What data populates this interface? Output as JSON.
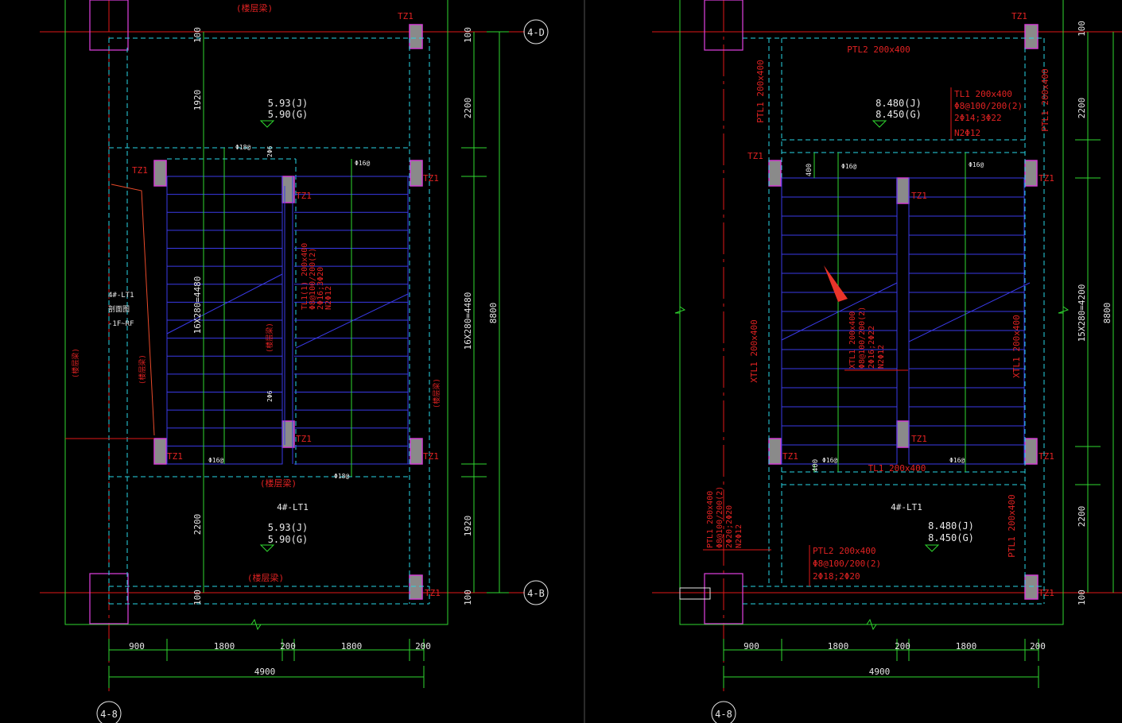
{
  "colors": {
    "background": "#000000",
    "dimension": "#2fd82f",
    "axis": "#e01818",
    "beam_dashed": "#29d6e6",
    "stair": "#3a3ae8",
    "wall": "#d23cd2",
    "column_fill": "#8a8a8a",
    "text": "#e8e8e8",
    "annotation": "#e02222"
  },
  "axes": {
    "top": "4-D",
    "bottom": "4-B",
    "left": "4-8"
  },
  "dims": {
    "bottom_row": [
      "900",
      "1800",
      "200",
      "1800",
      "200"
    ],
    "total": "4900",
    "d100": "100",
    "d1920": "1920",
    "d2200": "2200",
    "height": "8800"
  },
  "left": {
    "flight": "16X280=4480",
    "side_flight": "16X280=4480",
    "top_label": "(楼层梁)",
    "top_elev": [
      "5.93(J)",
      "5.90(G)"
    ],
    "bottom_elev": [
      "5.93(J)",
      "5.90(G)"
    ],
    "stair_name": "4#-LT1",
    "side_note": [
      "4#-LT1",
      "剖面图",
      "-1F~RF"
    ],
    "beam_label": [
      "TL1(1) 200x400",
      "Φ8@100/200(2)",
      "2Φ16;3Φ20",
      "N2Φ12"
    ],
    "rebar_top": "Φ18@",
    "rebar_top2": "Φ16@",
    "rebar_bottom": "Φ16@",
    "rebar_bottom2": "Φ18@",
    "mid_label": "2Φ6",
    "vertical_label": "(楼层梁)",
    "tz": "TZ1"
  },
  "right": {
    "flight": "15X280=4200",
    "ptl2_top": "PTL2 200x400",
    "ptl1_left": "PTL1 200x400",
    "ptl1_right": "PTL1 200x400",
    "top_elev": [
      "8.480(J)",
      "8.450(G)"
    ],
    "bottom_elev": [
      "8.480(J)",
      "8.450(G)"
    ],
    "tl1_top": [
      "TL1 200x400",
      "Φ8@100/200(2)",
      "2Φ14;3Φ22",
      "N2Φ12"
    ],
    "tl1_bottom": "TL1 200x400",
    "xtl1_left": "XTL1 200x400",
    "xtl1_right": "XTL1 200x400",
    "xtl1_mid": [
      "XTL1 200x400",
      "Φ8@100/200(2)",
      "2Φ16;2Φ22",
      "N2Φ12"
    ],
    "ptl1_bl": [
      "PTL1 200x400",
      "Φ8@100/200(2)",
      "2Φ20;2Φ20",
      "N2Φ12"
    ],
    "ptl2_bottom": [
      "PTL2 200x400",
      "Φ8@100/200(2)",
      "2Φ18;2Φ20"
    ],
    "stair_name": "4#-LT1",
    "dim400": "400",
    "rebar": "Φ16@",
    "tz": "TZ1"
  }
}
